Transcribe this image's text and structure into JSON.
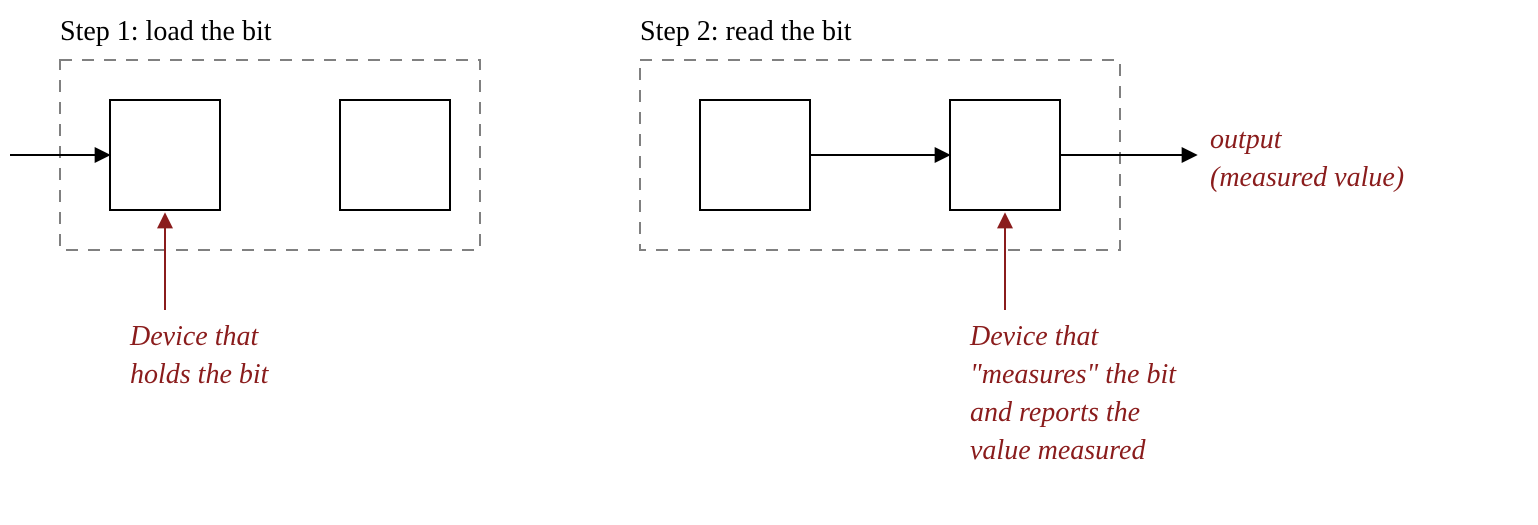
{
  "step1": {
    "title": "Step 1: load the bit",
    "annotation_line1": "Device that",
    "annotation_line2": "holds the bit"
  },
  "step2": {
    "title": "Step 2: read the bit",
    "output_line1": "output",
    "output_line2": "(measured value)",
    "annotation_line1": "Device that",
    "annotation_line2": "\"measures\" the bit",
    "annotation_line3": "and reports the",
    "annotation_line4": "value measured"
  },
  "colors": {
    "annotation": "#8a1c1c",
    "text": "#000000",
    "dashed_stroke": "#808080"
  }
}
